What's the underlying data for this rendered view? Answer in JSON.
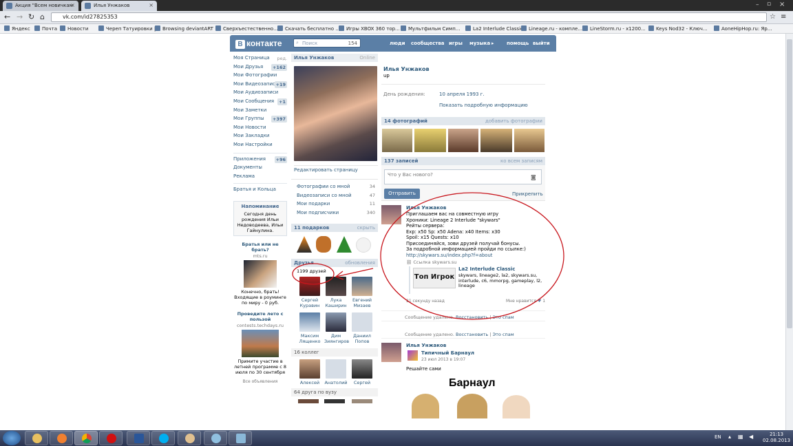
{
  "browser": {
    "tabs": [
      {
        "label": "Акция \"Всем новичкам ..."
      },
      {
        "label": "Илья Унжаков"
      }
    ],
    "url": "vk.com/id27825353",
    "bookmarks": [
      "Яндекс",
      "Почта",
      "Новости",
      "Череп Татуировки |...",
      "Browsing deviantART",
      "Сверхъестественно...",
      "Скачать бесплатно ...",
      "Игры XBOX 360 тор...",
      "Мультфильм Симп...",
      "La2 Interlude Classic",
      "Lineage.ru - компле...",
      "LineStorm.ru - x1200...",
      "Keys Nod32 - Ключ...",
      "AoneHipHop.ru: Яр..."
    ]
  },
  "vk": {
    "logo": "контакте",
    "logo_letter": "В",
    "search_placeholder": "Поиск",
    "search_count": "154",
    "nav": [
      "люди",
      "сообщества",
      "игры",
      "музыка",
      "помощь",
      "выйти"
    ]
  },
  "left_menu": {
    "items": [
      {
        "label": "Моя Страница",
        "badge": "",
        "edit": "ред."
      },
      {
        "label": "Мои Друзья",
        "badge": "+162",
        "edit": ""
      },
      {
        "label": "Мои Фотографии",
        "badge": "",
        "edit": ""
      },
      {
        "label": "Мои Видеозаписи",
        "badge": "+19",
        "edit": ""
      },
      {
        "label": "Мои Аудиозаписи",
        "badge": "",
        "edit": ""
      },
      {
        "label": "Мои Сообщения",
        "badge": "+1",
        "edit": ""
      },
      {
        "label": "Мои Заметки",
        "badge": "",
        "edit": ""
      },
      {
        "label": "Мои Группы",
        "badge": "+397",
        "edit": ""
      },
      {
        "label": "Мои Новости",
        "badge": "",
        "edit": ""
      },
      {
        "label": "Мои Закладки",
        "badge": "",
        "edit": ""
      },
      {
        "label": "Мои Настройки",
        "badge": "",
        "edit": ""
      }
    ],
    "items2": [
      {
        "label": "Приложения",
        "badge": "+96"
      },
      {
        "label": "Документы",
        "badge": ""
      },
      {
        "label": "Реклама",
        "badge": ""
      }
    ],
    "brothers": "Братья и Кольца",
    "reminder_title": "Напоминание",
    "reminder_text": "Сегодня день рождения Ильи Недоводеева, Ильи Гайнулина.",
    "ad1_title": "Братья или не брать?",
    "ad1_site": "mts.ru",
    "ad1_text": "Конечно, брать! Входящие в роуминге по миру - 0 руб.",
    "ad2_title": "Проведите лето с пользой",
    "ad2_site": "contests.techdays.ru",
    "ad2_text": "Примите участие в летней программе с 8 июля по 30 сентября",
    "all_ads": "Все объявления"
  },
  "profile": {
    "name_header": "Илья Унжаков",
    "status_online": "Online",
    "edit_page": "Редактировать страницу",
    "stats": [
      {
        "label": "Фотографии со мной",
        "n": "34"
      },
      {
        "label": "Видеозаписи со мной",
        "n": "47"
      },
      {
        "label": "Мои подарки",
        "n": "11"
      },
      {
        "label": "Мои подписчики",
        "n": "340"
      }
    ],
    "gifts_header": "11 подарков",
    "gifts_hide": "скрыть",
    "friends_header": "Друзья",
    "friends_updates": "обновления",
    "friends_count": "1199 друзей",
    "friends": [
      {
        "name": "Сергей Куравин"
      },
      {
        "name": "Лука Каширин"
      },
      {
        "name": "Евгений Мизаев"
      },
      {
        "name": "Максим Лященко"
      },
      {
        "name": "Дим Зиянгиров"
      },
      {
        "name": "Даниил Попов"
      }
    ],
    "colleagues_header": "16 коллег",
    "colleagues": [
      {
        "name": "Алексей"
      },
      {
        "name": "Анатолий"
      },
      {
        "name": "Сергей"
      }
    ],
    "uni_header": "64 друга по вузу"
  },
  "info": {
    "name": "Илья Унжаков",
    "status": "up",
    "bday_label": "День рождения:",
    "bday_value": "10 апреля 1993 г.",
    "more_info": "Показать подробную информацию",
    "photos_header": "14 фотографий",
    "photos_add": "добавить фотографии",
    "wall_header": "137 записей",
    "wall_filter": "ко всем записям",
    "wall_placeholder": "Что у Вас нового?",
    "send_button": "Отправить",
    "attach_button": "Прикрепить"
  },
  "post1": {
    "author": "Илья Унжаков",
    "lines": [
      "Приглашаем вас на совместную игру",
      "Хроники: Lineage 2 Interlude \"skywars\"",
      "Рейты сервера:",
      "Exp: x50 Sp: x50 Adena: x40 Items: x30",
      "Spoil: x15 Quests: x10",
      "Присоединяйся, зови друзей получай бонусы.",
      "За подробной информацией пройди по ссылке:)"
    ],
    "url": "http://skywars.su/index.php?f=about",
    "link_label": "Ссылка skywars.su",
    "attach_title": "La2 Interlude Classic",
    "attach_text": "skywars, lineage2, la2, skywars.su, interlude, c6, mmorpg, gameplay, l2, lineage",
    "attach_thumb_text": "Топ Игрок",
    "time": "21 секунду назад",
    "like": "Мне нравится",
    "like_count": "1"
  },
  "deleted": {
    "text": "Сообщение удалено.",
    "restore": "Восстановить",
    "spam": "Это спам"
  },
  "post2": {
    "author": "Илья Унжаков",
    "repost_from": "Типичный Барнаул",
    "date": "23 июл 2013 в 19:07",
    "text": "Решайте сами",
    "image_title": "Барнаул"
  },
  "taskbar": {
    "lang": "EN",
    "time": "21:13",
    "date": "02.08.2013"
  },
  "colors": {
    "vk_blue": "#5b7fa6",
    "link": "#2b587a",
    "annotation_red": "#c8161d"
  }
}
